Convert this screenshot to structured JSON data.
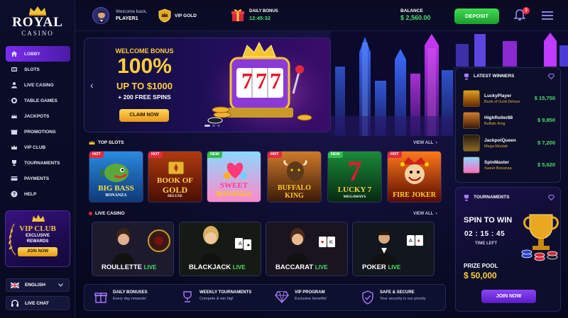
{
  "brand": {
    "name": "ROYAL",
    "sub": "CASINO"
  },
  "nav": {
    "items": [
      {
        "label": "LOBBY",
        "icon": "home-icon",
        "active": true
      },
      {
        "label": "SLOTS",
        "icon": "slots-icon"
      },
      {
        "label": "LIVE CASINO",
        "icon": "live-casino-icon"
      },
      {
        "label": "TABLE GAMES",
        "icon": "table-games-icon"
      },
      {
        "label": "JACKPOTS",
        "icon": "jackpots-icon"
      },
      {
        "label": "PROMOTIONS",
        "icon": "promotions-icon"
      },
      {
        "label": "VIP CLUB",
        "icon": "vip-club-icon"
      },
      {
        "label": "TOURNAMENTS",
        "icon": "trophy-icon"
      },
      {
        "label": "PAYMENTS",
        "icon": "payments-icon"
      },
      {
        "label": "HELP",
        "icon": "help-icon"
      }
    ]
  },
  "vip_card": {
    "title": "VIP CLUB",
    "line1": "EXCLUSIVE",
    "line2": "REWARDS",
    "button": "JOIN NOW"
  },
  "language": {
    "label": "ENGLISH"
  },
  "chat": {
    "label": "LIVE CHAT"
  },
  "header": {
    "welcome": "Welcome back,",
    "player": "PLAYER1",
    "vip_level": "VIP GOLD",
    "daily_bonus_label": "DAILY BONUS",
    "daily_bonus_time": "12:45:32",
    "balance_label": "BALANCE",
    "balance_value": "$ 2,560.00",
    "deposit": "DEPOSIT",
    "notifications": "3"
  },
  "hero": {
    "line1": "WELCOME BONUS",
    "line2": "100%",
    "line3": "UP TO $1000",
    "line4": "+ 200 FREE SPINS",
    "button": "CLAIM NOW",
    "reels": "777"
  },
  "top_slots": {
    "title": "TOP SLOTS",
    "view_all": "VIEW ALL",
    "games": [
      {
        "tag": "HOT",
        "name": "BIG BASS",
        "sub": "BONANZA",
        "color": "#1f6fb5"
      },
      {
        "tag": "HOT",
        "name": "BOOK OF",
        "sub": "GOLD",
        "sub2": "DELUXE",
        "color": "#8a2a0a"
      },
      {
        "tag": "NEW",
        "name": "SWEET",
        "sub": "BONANZA",
        "color": "#c43c8a"
      },
      {
        "tag": "HOT",
        "name": "BUFFALO",
        "sub": "KING",
        "color": "#7a3e12"
      },
      {
        "tag": "NEW",
        "name": "LUCKY 7",
        "sub": "MEGAWAYS",
        "color": "#0f6a2c"
      },
      {
        "tag": "HOT",
        "name": "FIRE JOKER",
        "sub": "",
        "color": "#9a1a0a"
      }
    ]
  },
  "live_casino": {
    "title": "LIVE CASINO",
    "view_all": "VIEW ALL",
    "games": [
      {
        "name": "ROULLETTE",
        "live": "LIVE"
      },
      {
        "name": "BLACKJACK",
        "live": "LIVE"
      },
      {
        "name": "BACCARAT",
        "live": "LIVE"
      },
      {
        "name": "POKER",
        "live": "LIVE"
      }
    ]
  },
  "features": [
    {
      "title": "DAILY BONUSES",
      "sub": "Every day rewards!"
    },
    {
      "title": "WEEKLY TOURNAMENTS",
      "sub": "Compete & win big!"
    },
    {
      "title": "VIP PROGRAM",
      "sub": "Exclusive benefits!"
    },
    {
      "title": "SAFE & SECURE",
      "sub": "Your security is our priority"
    }
  ],
  "winners": {
    "title": "LATEST WINNERS",
    "rows": [
      {
        "name": "LuckyPlayer",
        "game": "Book of Gold Deluxe",
        "amount": "$ 15,750"
      },
      {
        "name": "HighRoller88",
        "game": "Buffalo King",
        "amount": "$ 9,850"
      },
      {
        "name": "JackpotQueen",
        "game": "Mega Moolah",
        "amount": "$ 7,200"
      },
      {
        "name": "SpinMaster",
        "game": "Sweet Bonanza",
        "amount": "$ 5,620"
      }
    ]
  },
  "tournaments": {
    "title": "TOURNAMENTS",
    "heading": "SPIN TO WIN",
    "timer": "02 : 15 : 45",
    "time_left": "TIME LEFT",
    "prize_label": "PRIZE POOL",
    "prize_value": "$ 50,000",
    "button": "JOIN NOW"
  },
  "colors": {
    "accent": "#7a2cf0",
    "gold": "#ffce3a",
    "green": "#47e06a",
    "hot": "#e6293e",
    "new": "#2fbf4a"
  }
}
